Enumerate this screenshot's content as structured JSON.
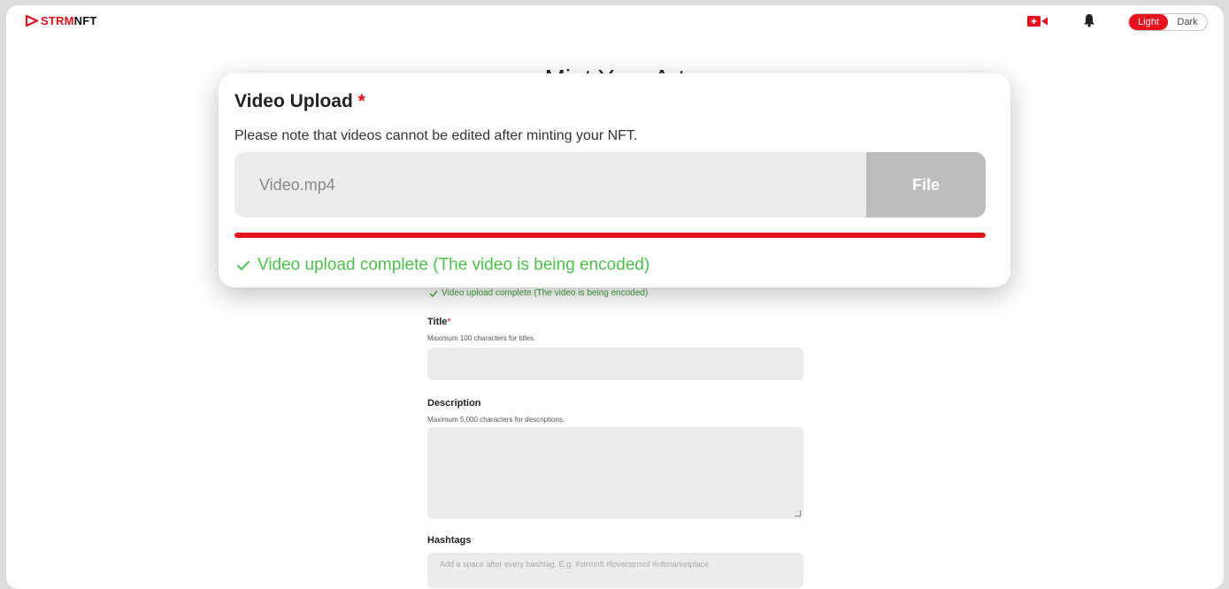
{
  "header": {
    "logo_text_red": "STRM",
    "logo_text_black": "NFT",
    "theme_light": "Light",
    "theme_dark": "Dark"
  },
  "page": {
    "title": "Mint Your Art"
  },
  "form": {
    "upload_status": "Video upload complete (The video is being encoded)",
    "title_label": "Title",
    "title_required": "*",
    "title_hint": "Maximum 100 characters for titles.",
    "description_label": "Description",
    "description_hint": "Maximum 5,000 characters for descriptions.",
    "hashtags_label": "Hashtags",
    "hashtags_placeholder": "Add a space after every hashtag. E.g. #strmnft #loverstrmnf #nftmarketplace"
  },
  "modal": {
    "title": "Video Upload",
    "required": "*",
    "note": "Please note that videos cannot be edited after minting your NFT.",
    "file_name": "Video.mp4",
    "file_button": "File",
    "progress": 1.0,
    "status": "Video upload complete (The video is being encoded)"
  },
  "colors": {
    "brand": "#e8101c",
    "success": "#4cbf4a"
  }
}
